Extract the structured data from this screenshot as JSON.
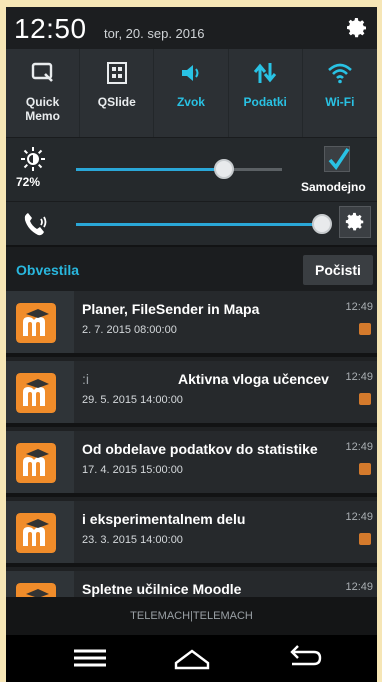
{
  "status_bar": {
    "time": "12:50",
    "date": "tor, 20. sep. 2016"
  },
  "quick_settings": [
    {
      "label": "Quick\nMemo",
      "icon": "quickmemo-icon",
      "active": false
    },
    {
      "label": "QSlide",
      "icon": "qslide-icon",
      "active": false
    },
    {
      "label": "Zvok",
      "icon": "speaker-icon",
      "active": true
    },
    {
      "label": "Podatki",
      "icon": "data-arrows-icon",
      "active": true
    },
    {
      "label": "Wi-Fi",
      "icon": "wifi-icon",
      "active": true
    }
  ],
  "brightness": {
    "percent_label": "72%",
    "level": 0.72,
    "auto_label": "Samodejno",
    "auto_checked": true
  },
  "volume": {
    "level": 1.0
  },
  "notifications_header": {
    "title": "Obvestila",
    "clear_label": "Počisti"
  },
  "notifications": [
    {
      "title": "Planer, FileSender in Mapa",
      "title_prefix": "",
      "subtitle": "2. 7. 2015 08:00:00",
      "time": "12:49"
    },
    {
      "title": "Aktivna vloga učencev",
      "title_prefix": ":i",
      "subtitle": "29. 5. 2015 14:00:00",
      "time": "12:49"
    },
    {
      "title": "Od obdelave podatkov do statistike",
      "title_prefix": "",
      "subtitle": "17. 4. 2015 15:00:00",
      "time": "12:49"
    },
    {
      "title": "i eksperimentalnem delu",
      "title_prefix": "",
      "subtitle": "23. 3. 2015 14:00:00",
      "time": "12:49"
    },
    {
      "title": "Spletne učilnice Moodle",
      "title_prefix": "",
      "subtitle": "",
      "time": "12:49"
    }
  ],
  "carrier": "TELEMACH|TELEMACH",
  "colors": {
    "accent": "#29c2e4",
    "app_icon": "#f08c2a"
  }
}
